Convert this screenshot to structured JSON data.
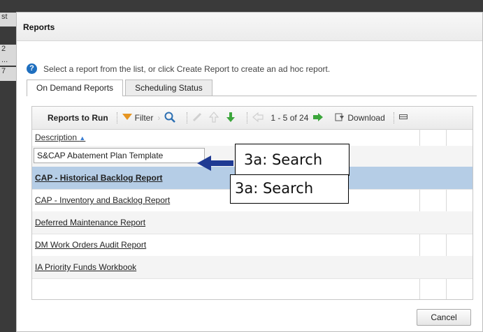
{
  "background": {
    "snippets": [
      "st",
      "2",
      "...",
      "7"
    ]
  },
  "dialog": {
    "title": "Reports",
    "info_text": "Select a report from the list, or click Create Report to create an ad hoc report.",
    "tabs": [
      {
        "label": "On Demand Reports",
        "active": true
      },
      {
        "label": "Scheduling Status",
        "active": false
      }
    ],
    "toolbar": {
      "title": "Reports to Run",
      "filter_label": "Filter",
      "pagination": "1 - 5 of 24",
      "download_label": "Download"
    },
    "grid": {
      "column_header": "Description",
      "search_value": "S&CAP Abatement Plan Template",
      "rows": [
        {
          "label": "CAP - Historical Backlog Report",
          "selected": true
        },
        {
          "label": "CAP - Inventory and Backlog Report",
          "selected": false
        },
        {
          "label": "Deferred Maintenance Report",
          "selected": false
        },
        {
          "label": "DM Work Orders Audit Report",
          "selected": false
        },
        {
          "label": "IA Priority Funds Workbook",
          "selected": false
        }
      ]
    },
    "cancel_label": "Cancel"
  },
  "annotations": {
    "callout_1": "3a: Search",
    "callout_2": "3a: Search",
    "arrow_color": "#1f3a93"
  },
  "colors": {
    "selected_row": "#b5cde6",
    "info_icon": "#1f6fbf"
  }
}
